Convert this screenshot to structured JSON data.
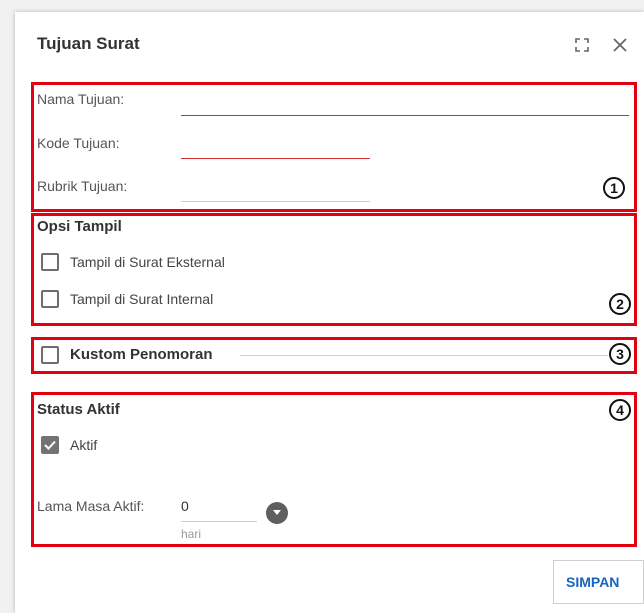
{
  "dialog": {
    "title": "Tujuan Surat",
    "expand_icon": "expand-icon",
    "close_icon": "close-icon"
  },
  "section1": {
    "number": "1",
    "fields": [
      {
        "label": "Nama Tujuan:",
        "value": ""
      },
      {
        "label": "Kode Tujuan:",
        "value": ""
      },
      {
        "label": "Rubrik Tujuan:",
        "value": ""
      }
    ]
  },
  "section2": {
    "number": "2",
    "title": "Opsi Tampil",
    "options": [
      {
        "label": "Tampil di Surat Eksternal",
        "checked": false
      },
      {
        "label": "Tampil di Surat Internal",
        "checked": false
      }
    ]
  },
  "section3": {
    "number": "3",
    "label": "Kustom Penomoran",
    "checked": false
  },
  "section4": {
    "number": "4",
    "title": "Status Aktif",
    "aktif_label": "Aktif",
    "aktif_checked": true,
    "lama_label": "Lama Masa Aktif:",
    "lama_value": "0",
    "lama_suffix": "hari"
  },
  "actions": {
    "save_label": "SIMPAN"
  },
  "colors": {
    "highlight_border": "#e3000f",
    "required_underline": "#d32f2f",
    "primary": "#1565c0"
  }
}
